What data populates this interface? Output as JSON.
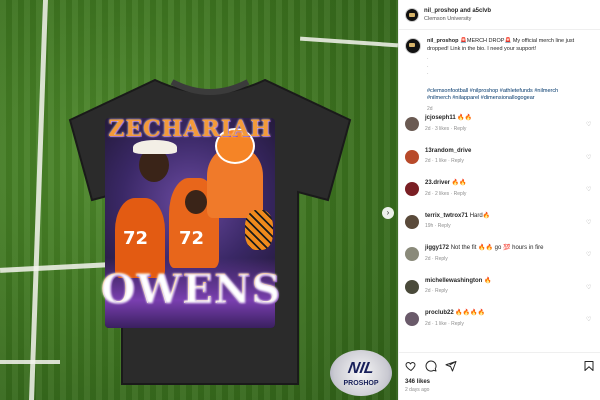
{
  "post": {
    "header_user": "nil_proshop and a5clvb",
    "header_sub": "Clemson University",
    "caption_user": "nil_proshop",
    "caption_text": "🚨MERCH DROP🚨 My official merch line just dropped! Link in the bio. I need your support!",
    "caption_dots": ".\n.\n.",
    "caption_tags": "#clemsonfootball #nilproshop #athletefunds #nilmerch",
    "caption_tags2": "#nilmerch #nilapparel #dimensionallogogear",
    "caption_time": "2d",
    "artwork": {
      "name_top": "ZECHARIAH",
      "name_bottom": "OWENS",
      "num1": "72",
      "num2": "72"
    },
    "logo": {
      "text": "NIL",
      "sub": "PROSHOP"
    },
    "likes": "346 likes",
    "date": "2 days ago"
  },
  "comments": [
    {
      "user": "jcjoseph11",
      "text": "🔥🔥",
      "meta": "2d · 3 likes · Reply",
      "avatar_color": "#6a5a52"
    },
    {
      "user": "13random_drive",
      "text": "",
      "meta": "2d · 1 like · Reply",
      "avatar_color": "#b84a2a"
    },
    {
      "user": "23.driver",
      "text": "🔥🔥",
      "meta": "2d · 2 likes · Reply",
      "avatar_color": "#7a1f24"
    },
    {
      "user": "terrix_twtrox71",
      "text": "Hard🔥",
      "meta": "19h · Reply",
      "avatar_color": "#5a4a3a"
    },
    {
      "user": "jiggy172",
      "text": "Not the fit 🔥🔥 go 💯 hours in fire",
      "meta": "2d · Reply",
      "avatar_color": "#8a8a7a"
    },
    {
      "user": "michellewashington",
      "text": "🔥",
      "meta": "2d · Reply",
      "avatar_color": "#4a4a3a"
    },
    {
      "user": "proclub22",
      "text": "🔥🔥🔥🔥",
      "meta": "2d · 1 like · Reply",
      "avatar_color": "#6a5a6a"
    }
  ],
  "colors": {
    "link": "#00376b",
    "muted": "#8e8e8e",
    "orange": "#f39a3a",
    "purple": "#7a3fb0"
  },
  "icons": [
    "heart-icon",
    "comment-icon",
    "share-icon",
    "bookmark-icon",
    "chevron-right-icon"
  ]
}
